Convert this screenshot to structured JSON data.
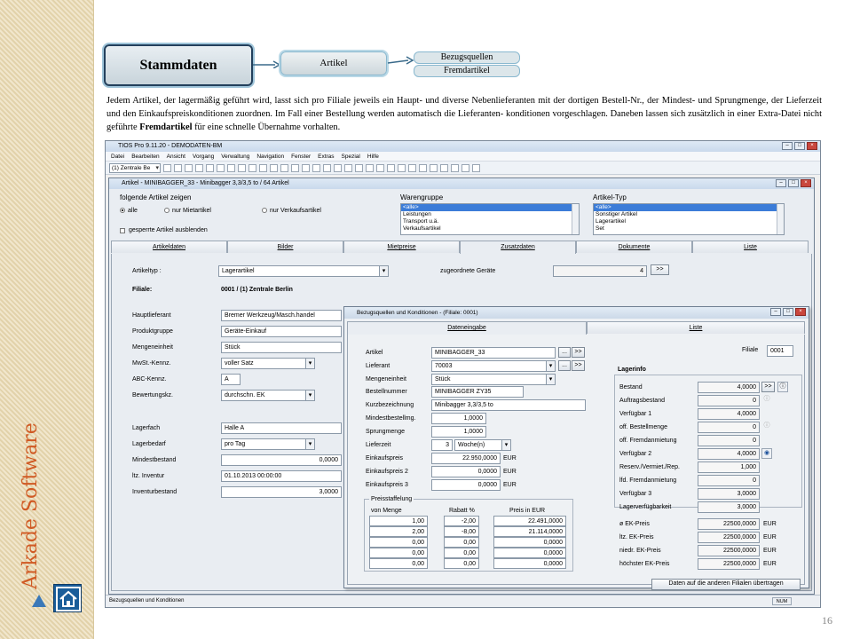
{
  "sidebar": {
    "brand": "Arkade Software",
    "page_number": "16"
  },
  "header_boxes": {
    "main": "Stammdaten",
    "sub1": "Artikel",
    "sub2a": "Bezugsquellen",
    "sub2b": "Fremdartikel"
  },
  "paragraph": {
    "text_before": "Jedem Artikel,  der lagermäßig geführt wird, lasst sich pro Filiale jeweils  ein Haupt- und diverse Nebenlieferanten mit der dortigen Bestell-Nr.,  der Mindest- und Sprungmenge, der Lieferzeit  und den Einkaufspreiskonditionen zuordnen. Im Fall einer Bestellung werden automatisch die Lieferanten- konditionen vorgeschlagen.  Daneben lassen sich zusätzlich in einer Extra-Datei nicht geführte ",
    "bold": "Fremdartikel",
    "text_after": " für eine schnelle Übernahme vorhalten."
  },
  "app": {
    "title": "TIOS Pro 9.11.20 - DEMODATEN-BM",
    "menu": [
      "Datei",
      "Bearbeiten",
      "Ansicht",
      "Vorgang",
      "Verwaltung",
      "Navigation",
      "Fenster",
      "Extras",
      "Spezial",
      "Hilfe"
    ],
    "branch_combo": "(1) Zentrale Be",
    "status_left": "Bezugsquellen und Konditionen",
    "status_num": "NUM"
  },
  "article_window": {
    "title": "Artikel - MINIBAGGER_33 - Minibagger 3,3/3,5 to / 64 Artikel",
    "filter_label": "folgende Artikel zeigen",
    "radios": [
      "alle",
      "nur Mietartikel",
      "nur Verkaufsartikel"
    ],
    "hide_locked": "gesperrte Artikel ausblenden",
    "warengruppe_label": "Warengruppe",
    "warengruppe_items": [
      "<alle>",
      "Leistungen",
      "Transport u.ä.",
      "Verkaufsartikel"
    ],
    "artikeltyp_label": "Artikel-Typ",
    "artikeltyp_items": [
      "<alle>",
      "Sonstiger Artikel",
      "Lagerartikel",
      "Set"
    ],
    "tabs": [
      "Artikeldaten",
      "Bilder",
      "Mietpreise",
      "Zusatzdaten",
      "Dokumente",
      "Liste"
    ],
    "artikeltyp_field_label": "Artikeltyp :",
    "artikeltyp_value": "Lagerartikel",
    "zugeordnete_label": "zugeordnete Geräte",
    "zugeordnete_value": "4",
    "more_btn": ">>",
    "filiale_label": "Filiale:",
    "filiale_value": "0001 / (1) Zentrale Berlin",
    "fields": [
      {
        "label": "Hauptlieferant",
        "value": "Bremer Werkzeug/Masch.handel"
      },
      {
        "label": "Produktgruppe",
        "value": "Geräte-Einkauf"
      },
      {
        "label": "Mengeneinheit",
        "value": "Stück"
      },
      {
        "label": "MwSt.-Kennz.",
        "value": "voller Satz"
      },
      {
        "label": "ABC-Kennz.",
        "value": "A"
      },
      {
        "label": "Bewertungskz.",
        "value": "durchschn. EK"
      }
    ],
    "fields2": [
      {
        "label": "Lagerfach",
        "value": "Halle A"
      },
      {
        "label": "Lagerbedarf",
        "value": "pro Tag"
      },
      {
        "label": "Mindestbestand",
        "value": "0,0000"
      },
      {
        "label": "ltz. Inventur",
        "value": "01.10.2013 00:00:00"
      },
      {
        "label": "Inventurbestand",
        "value": "3,0000"
      }
    ]
  },
  "dialog": {
    "title": "Bezugsquellen und Konditionen - (Filiale: 0001)",
    "tabs": [
      "Dateneingabe",
      "Liste"
    ],
    "artikel_label": "Artikel",
    "artikel_value": "MINIBAGGER_33",
    "lieferant_label": "Lieferant",
    "lieferant_value": "70003",
    "mengeneinheit_label": "Mengeneinheit",
    "mengeneinheit_value": "Stück",
    "bestellnummer_label": "Bestellnummer",
    "bestellnummer_value": "MINIBAGGER ZY35",
    "kurz_label": "Kurzbezeichnung",
    "kurz_value": "Minibagger 3,3/3,5 to",
    "mindest_label": "Mindestbestellmg.",
    "mindest_value": "1,0000",
    "sprung_label": "Sprungmenge",
    "sprung_value": "1,0000",
    "lieferzeit_label": "Lieferzeit",
    "lieferzeit_value": "3",
    "lieferzeit_unit": "Woche(n)",
    "ek_labels": [
      "Einkaufspreis",
      "Einkaufspreis 2",
      "Einkaufspreis 3"
    ],
    "ek_values": [
      "22.950,0000",
      "0,0000",
      "0,0000"
    ],
    "currency": "EUR",
    "dots": "...",
    "more": ">>",
    "staffel_title": "Preisstaffelung",
    "staffel_headers": [
      "von Menge",
      "Rabatt %",
      "Preis in   EUR"
    ],
    "staffel_rows": [
      [
        "1,00",
        "-2,00",
        "22.491,0000"
      ],
      [
        "2,00",
        "-8,00",
        "21.114,0000"
      ],
      [
        "0,00",
        "0,00",
        "0,0000"
      ],
      [
        "0,00",
        "0,00",
        "0,0000"
      ],
      [
        "0,00",
        "0,00",
        "0,0000"
      ]
    ],
    "filiale_label": "Filiale",
    "filiale_value": "0001",
    "lagerinfo_title": "Lagerinfo",
    "lagerinfo": [
      {
        "label": "Bestand",
        "value": "4,0000"
      },
      {
        "label": "Auftragsbestand",
        "value": "0"
      },
      {
        "label": "Verfügbar 1",
        "value": "4,0000"
      },
      {
        "label": "off. Bestellmenge",
        "value": "0"
      },
      {
        "label": "off. Fremdanmietung",
        "value": "0"
      },
      {
        "label": "Verfügbar 2",
        "value": "4,0000"
      },
      {
        "label": "Reserv./Vermiet./Rep.",
        "value": "1,000"
      },
      {
        "label": "lfd. Fremdanmietung",
        "value": "0"
      },
      {
        "label": "Verfügbar 3",
        "value": "3,0000"
      },
      {
        "label": "Lagerverfügbarkeit",
        "value": "3,0000"
      }
    ],
    "ek_summary": [
      {
        "label": "ø EK-Preis",
        "value": "22500,0000"
      },
      {
        "label": "ltz. EK-Preis",
        "value": "22500,0000"
      },
      {
        "label": "niedr. EK-Preis",
        "value": "22500,0000"
      },
      {
        "label": "höchster EK-Preis",
        "value": "22500,0000"
      }
    ],
    "transfer_btn": "Daten auf die anderen Filialen übertragen"
  }
}
